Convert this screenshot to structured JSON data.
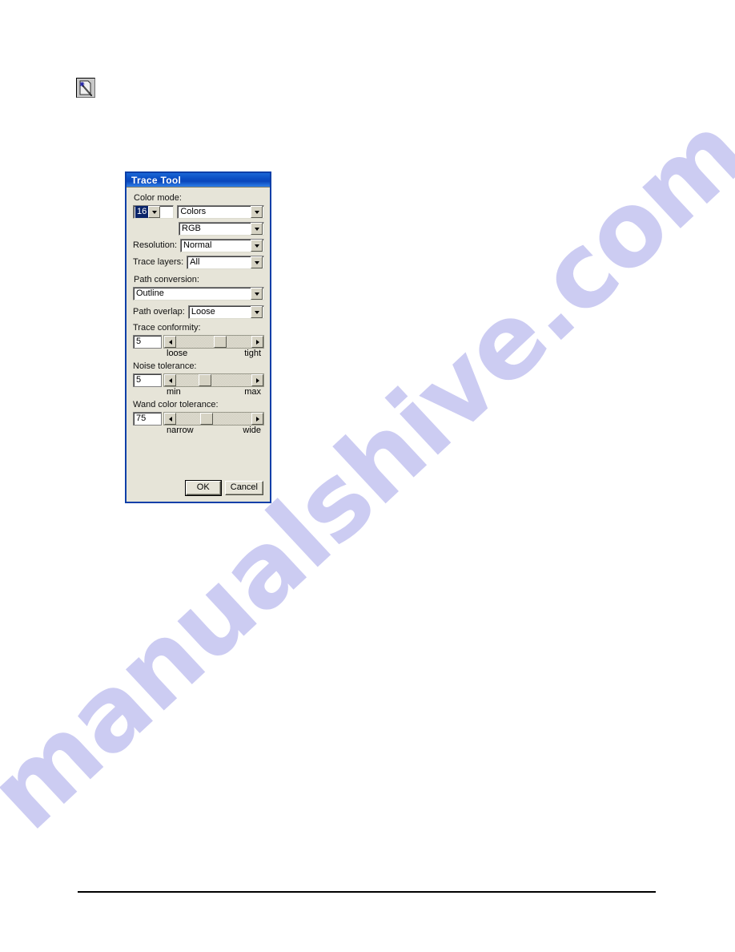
{
  "page": {
    "watermark_text": "manualshive.com",
    "watermark_color": "#ccccf2",
    "background_color": "#ffffff"
  },
  "toolbar_icon": {
    "name": "trace-tool-icon",
    "tooltip": "Trace Tool"
  },
  "dialog": {
    "title": "Trace Tool",
    "title_bar_color": "#0b4fc4",
    "border_color": "#0a3fa8",
    "background_color": "#e6e4d8",
    "sections": {
      "color_mode": {
        "label": "Color mode:",
        "count_value": "16",
        "count_selected": true,
        "unit_value": "Colors",
        "model_value": "RGB"
      },
      "resolution": {
        "label": "Resolution:",
        "value": "Normal"
      },
      "trace_layers": {
        "label": "Trace layers:",
        "value": "All"
      },
      "path_conversion": {
        "label": "Path conversion:",
        "value": "Outline"
      },
      "path_overlap": {
        "label": "Path overlap:",
        "value": "Loose"
      },
      "trace_conformity": {
        "label": "Trace conformity:",
        "value": "5",
        "min_label": "loose",
        "max_label": "tight",
        "thumb_percent": 50
      },
      "noise_tolerance": {
        "label": "Noise tolerance:",
        "value": "5",
        "min_label": "min",
        "max_label": "max",
        "thumb_percent": 30
      },
      "wand_color_tolerance": {
        "label": "Wand color tolerance:",
        "value": "75",
        "min_label": "narrow",
        "max_label": "wide",
        "thumb_percent": 32
      }
    },
    "buttons": {
      "ok": "OK",
      "cancel": "Cancel"
    }
  }
}
